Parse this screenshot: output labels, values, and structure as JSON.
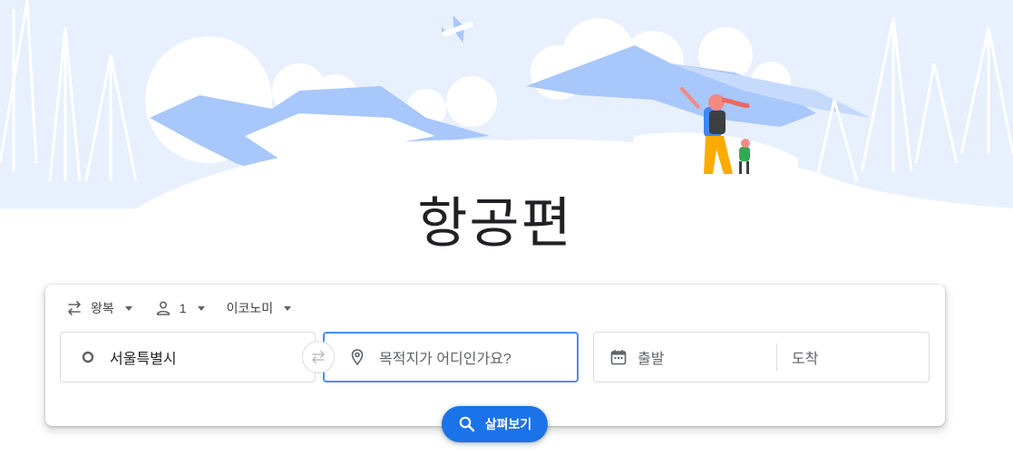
{
  "page": {
    "title": "항공편"
  },
  "options": {
    "trip_type": "왕복",
    "passengers": "1",
    "cabin_class": "이코노미"
  },
  "search": {
    "origin_value": "서울특별시",
    "destination_placeholder": "목적지가 어디인가요?",
    "depart_placeholder": "출발",
    "return_placeholder": "도착"
  },
  "actions": {
    "explore_label": "살펴보기"
  },
  "icons": {
    "trip_type": "swap-arrows-icon",
    "passengers": "person-icon",
    "origin": "circle-icon",
    "destination": "location-pin-icon",
    "swap": "swap-arrows-icon",
    "calendar": "calendar-icon",
    "search": "search-icon"
  },
  "colors": {
    "accent": "#1a73e8",
    "focus_border": "#4c8df5",
    "mountain_blue": "#a8c7fa",
    "sky": "#e8f0fe"
  }
}
